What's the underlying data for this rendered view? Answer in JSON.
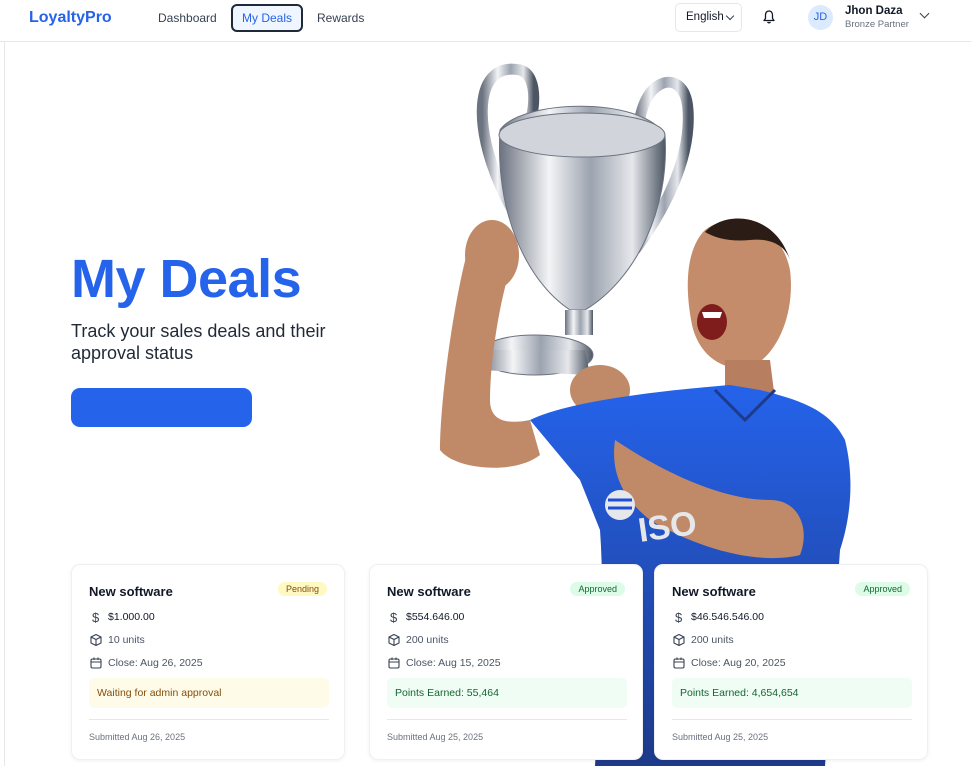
{
  "header": {
    "logo": "LoyaltyPro",
    "nav": [
      {
        "label": "Dashboard",
        "active": false
      },
      {
        "label": "My Deals",
        "active": true
      },
      {
        "label": "Rewards",
        "active": false
      }
    ],
    "language": "English",
    "user": {
      "initials": "JD",
      "name": "Jhon Daza",
      "tier": "Bronze Partner"
    }
  },
  "hero": {
    "title": "My Deals",
    "subtitle": "Track your sales deals and their approval status",
    "button_label": "",
    "jersey_text": "ISO"
  },
  "deals": [
    {
      "title": "New software",
      "status": "Pending",
      "amount": "$1.000.00",
      "units": "10 units",
      "close": "Close: Aug 26, 2025",
      "status_message": "Waiting for admin approval",
      "submitted": "Submitted Aug 26, 2025"
    },
    {
      "title": "New software",
      "status": "Approved",
      "amount": "$554.646.00",
      "units": "200 units",
      "close": "Close: Aug 15, 2025",
      "status_message": "Points Earned: 55,464",
      "submitted": "Submitted Aug 25, 2025"
    },
    {
      "title": "New software",
      "status": "Approved",
      "amount": "$46.546.546.00",
      "units": "200 units",
      "close": "Close: Aug 20, 2025",
      "status_message": "Points Earned: 4,654,654",
      "submitted": "Submitted Aug 25, 2025"
    }
  ],
  "colors": {
    "brand": "#2563eb",
    "pending_bg": "#fef9c3",
    "approved_bg": "#dcfce7",
    "jersey": "#1d4ed8"
  }
}
